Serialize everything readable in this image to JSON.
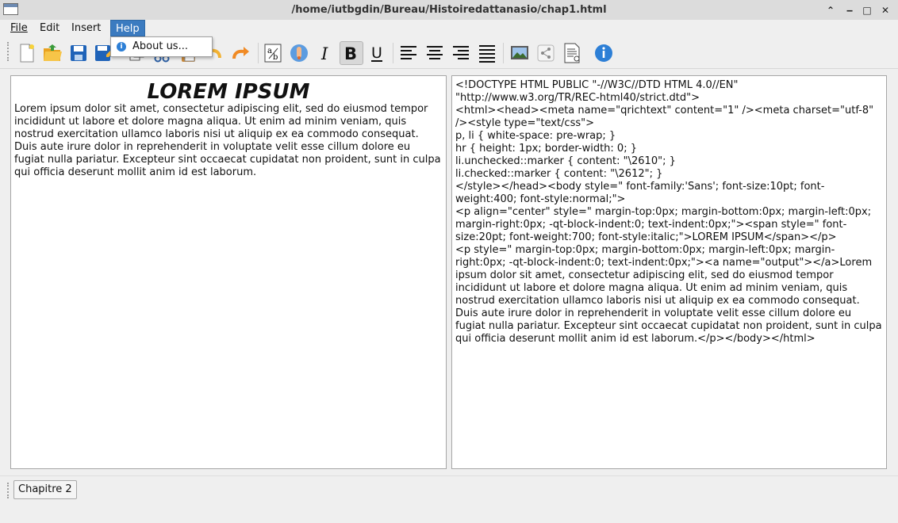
{
  "window": {
    "title": "/home/iutbgdin/Bureau/Histoiredattanasio/chap1.html",
    "buttons": {
      "collapse": "⌃",
      "minimize": "‒",
      "maximize": "□",
      "close": "✕"
    }
  },
  "menubar": {
    "items": [
      "File",
      "Edit",
      "Insert",
      "Help"
    ],
    "active": "Help"
  },
  "help_menu": {
    "items": [
      {
        "label": "About us...",
        "icon": "info-icon"
      }
    ]
  },
  "toolbar": {
    "buttons": [
      {
        "icon": "new-file-icon"
      },
      {
        "icon": "open-folder-icon"
      },
      {
        "icon": "save-icon"
      },
      {
        "icon": "save-as-icon"
      },
      {
        "icon": "copy-icon"
      },
      {
        "icon": "cut-icon"
      },
      {
        "icon": "paste-icon"
      },
      {
        "icon": "undo-icon"
      },
      {
        "icon": "redo-icon"
      },
      {
        "icon": "spellcheck-icon"
      },
      {
        "icon": "text-color-icon"
      },
      {
        "icon": "italic-icon",
        "glyph": "I"
      },
      {
        "icon": "bold-icon",
        "glyph": "B",
        "pressed": true
      },
      {
        "icon": "underline-icon",
        "glyph": "U"
      },
      {
        "icon": "align-left-icon"
      },
      {
        "icon": "align-center-icon"
      },
      {
        "icon": "align-right-icon"
      },
      {
        "icon": "justify-icon"
      },
      {
        "icon": "insert-image-icon"
      },
      {
        "icon": "share-icon"
      },
      {
        "icon": "document-icon"
      },
      {
        "icon": "info-icon",
        "glyph": "i"
      }
    ],
    "colors": {
      "accent": "#3b7bc0",
      "info": "#2d7fd6",
      "folder": "#f2b233",
      "redo": "#f08a24"
    }
  },
  "editor": {
    "heading": "LOREM IPSUM",
    "body": "Lorem ipsum dolor sit amet, consectetur adipiscing elit, sed do eiusmod tempor incididunt ut labore et dolore magna aliqua. Ut enim ad minim veniam, quis nostrud exercitation ullamco laboris nisi ut aliquip ex ea commodo consequat. Duis aute irure dolor in reprehenderit in voluptate velit esse cillum dolore eu fugiat nulla pariatur. Excepteur sint occaecat cupidatat non proident, sunt in culpa qui officia deserunt mollit anim id est laborum."
  },
  "source": {
    "html": "<!DOCTYPE HTML PUBLIC \"-//W3C//DTD HTML 4.0//EN\" \"http://www.w3.org/TR/REC-html40/strict.dtd\">\n<html><head><meta name=\"qrichtext\" content=\"1\" /><meta charset=\"utf-8\" /><style type=\"text/css\">\np, li { white-space: pre-wrap; }\nhr { height: 1px; border-width: 0; }\nli.unchecked::marker { content: \"\\2610\"; }\nli.checked::marker { content: \"\\2612\"; }\n</style></head><body style=\" font-family:'Sans'; font-size:10pt; font-weight:400; font-style:normal;\">\n<p align=\"center\" style=\" margin-top:0px; margin-bottom:0px; margin-left:0px; margin-right:0px; -qt-block-indent:0; text-indent:0px;\"><span style=\" font-size:20pt; font-weight:700; font-style:italic;\">LOREM IPSUM</span></p>\n<p style=\" margin-top:0px; margin-bottom:0px; margin-left:0px; margin-right:0px; -qt-block-indent:0; text-indent:0px;\"><a name=\"output\"></a>Lorem ipsum dolor sit amet, consectetur adipiscing elit, sed do eiusmod tempor incididunt ut labore et dolore magna aliqua. Ut enim ad minim veniam, quis nostrud exercitation ullamco laboris nisi ut aliquip ex ea commodo consequat. Duis aute irure dolor in reprehenderit in voluptate velit esse cillum dolore eu fugiat nulla pariatur. Excepteur sint occaecat cupidatat non proident, sunt in culpa qui officia deserunt mollit anim id est laborum.</p></body></html>"
  },
  "tabs": {
    "chapter_button": "Chapitre 2"
  }
}
